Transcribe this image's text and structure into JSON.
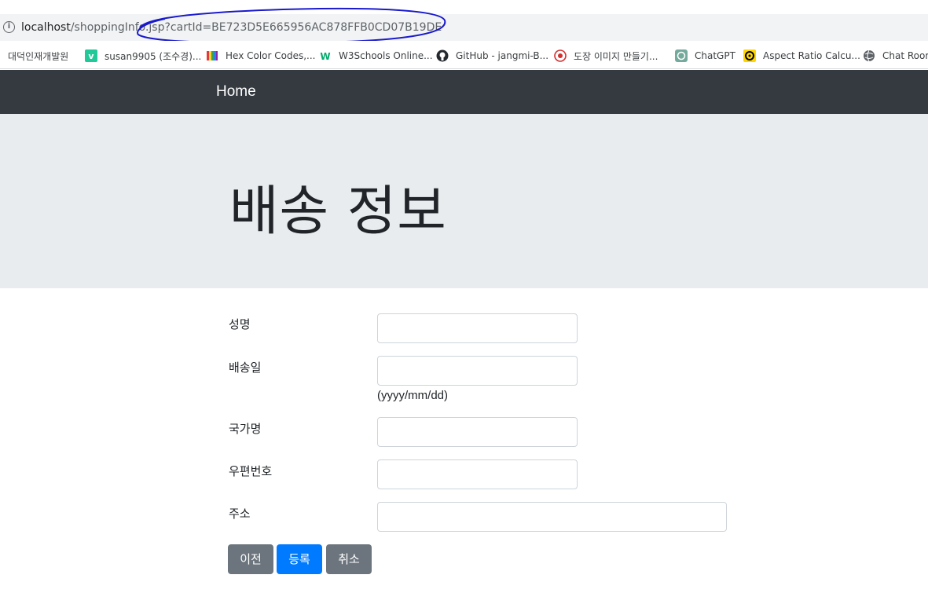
{
  "browser": {
    "url_host": "localhost",
    "url_path": "/shoppingInfo.jsp?cartId=BE723D5E665956AC878FFB0CD07B19DE",
    "bookmarks": [
      {
        "label": "대덕인재개발원",
        "icon": "bookmark-icon"
      },
      {
        "label": "susan9905 (조수경)...",
        "icon": "velog-icon"
      },
      {
        "label": "Hex Color Codes,...",
        "icon": "color-book-icon"
      },
      {
        "label": "W3Schools Online...",
        "icon": "w3schools-icon"
      },
      {
        "label": "GitHub - jangmi-B...",
        "icon": "github-icon"
      },
      {
        "label": "도장 이미지 만들기...",
        "icon": "stamp-icon"
      },
      {
        "label": "ChatGPT",
        "icon": "chatgpt-icon"
      },
      {
        "label": "Aspect Ratio Calcu...",
        "icon": "aspect-ratio-icon"
      },
      {
        "label": "Chat Room",
        "icon": "globe-icon"
      }
    ]
  },
  "navbar": {
    "brand": "Home"
  },
  "jumbotron": {
    "title": "배송 정보"
  },
  "form": {
    "name_label": "성명",
    "ship_date_label": "배송일",
    "ship_date_hint": "(yyyy/mm/dd)",
    "country_label": "국가명",
    "zip_label": "우편번호",
    "address_label": "주소"
  },
  "buttons": {
    "prev": "이전",
    "register": "등록",
    "cancel": "취소"
  },
  "colors": {
    "navbar": "#343a40",
    "jumbotron": "#e9ecef",
    "primary": "#007bff",
    "secondary": "#6c757d",
    "annotation": "#1a1acd"
  }
}
